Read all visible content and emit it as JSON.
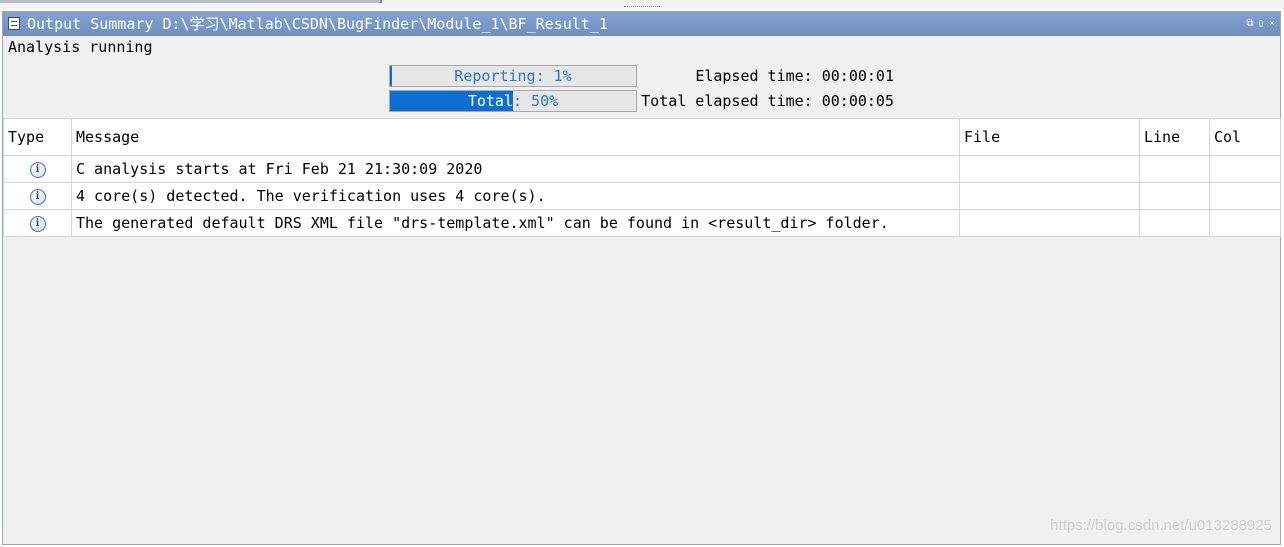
{
  "panel": {
    "title": "Output Summary D:\\学习\\Matlab\\CSDN\\BugFinder\\Module_1\\BF_Result_1",
    "window_buttons": [
      "⧉",
      "▯",
      "×"
    ]
  },
  "status": {
    "text": "Analysis running"
  },
  "progress": {
    "reporting": {
      "label": "Reporting: 1%",
      "fraction": 0.01
    },
    "total": {
      "label": "Total: 50%",
      "fraction": 0.5
    },
    "elapsed_time": "Elapsed time: 00:00:01",
    "total_elapsed_time": "Total elapsed time: 00:00:05"
  },
  "table": {
    "columns": [
      "Type",
      "Message",
      "File",
      "Line",
      "Col"
    ],
    "rows": [
      {
        "type_icon": "info-icon",
        "message": "C analysis starts at Fri Feb 21 21:30:09 2020",
        "file": "",
        "line": "",
        "col": ""
      },
      {
        "type_icon": "info-icon",
        "message": "4 core(s) detected. The verification uses 4 core(s).",
        "file": "",
        "line": "",
        "col": ""
      },
      {
        "type_icon": "info-icon",
        "message": "The generated default DRS XML file \"drs-template.xml\" can be found in <result_dir> folder.",
        "file": "",
        "line": "",
        "col": ""
      }
    ]
  },
  "watermark": "https://blog.csdn.net/u013288925",
  "colors": {
    "titlebar": "#7795c6",
    "progress_fill": "#0d6fd2",
    "progress_text": "#2a79c4"
  }
}
